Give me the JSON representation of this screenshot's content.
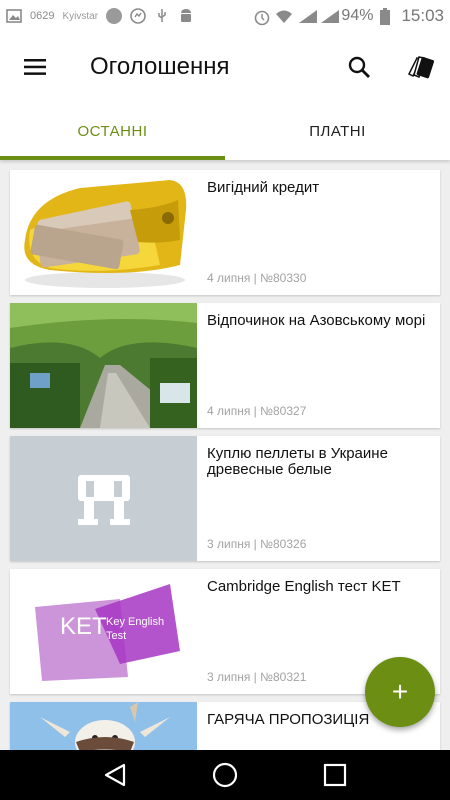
{
  "status_bar": {
    "left_text": "0629",
    "small_text": "Kyivstar",
    "battery": "94%",
    "time": "15:03"
  },
  "app_bar": {
    "title": "Оголошення"
  },
  "tabs": [
    {
      "label": "ОСТАННІ",
      "active": true
    },
    {
      "label": "ПЛАТНІ",
      "active": false
    }
  ],
  "listings": [
    {
      "title": "Вигідний кредит",
      "meta": "4 липня | №80330",
      "image": "wallet-money"
    },
    {
      "title": "Відпочинок на Азовському морі",
      "meta": "4 липня | №80327",
      "image": "garden-path"
    },
    {
      "title": "Куплю пеллеты в Украине древесные белые",
      "meta": "3 липня | №80326",
      "image": "placeholder"
    },
    {
      "title": "Cambridge English тест KET",
      "meta": "3 липня | №80321",
      "image": "ket-logo",
      "image_text": {
        "ket": "KET",
        "key": "Key English",
        "test": "Test"
      }
    },
    {
      "title": "ГАРЯЧА ПРОПОЗИЦІЯ",
      "meta": "",
      "image": "cow"
    }
  ],
  "fab": {
    "label": "+"
  },
  "colors": {
    "accent": "#6b8e13",
    "placeholder_bg": "#c6cdd3"
  }
}
